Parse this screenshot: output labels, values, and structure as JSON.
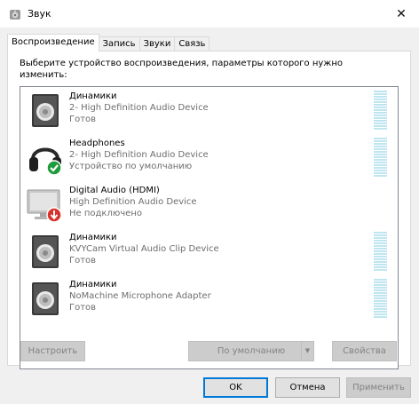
{
  "window": {
    "title": "Звук"
  },
  "tabs": [
    {
      "label": "Воспроизведение"
    },
    {
      "label": "Запись"
    },
    {
      "label": "Звуки"
    },
    {
      "label": "Связь"
    }
  ],
  "instruction": "Выберите устройство воспроизведения, параметры которого нужно изменить:",
  "devices": [
    {
      "name": "Динамики",
      "description": "2- High Definition Audio Device",
      "status": "Готов",
      "icon": "speaker-icon"
    },
    {
      "name": "Headphones",
      "description": "2- High Definition Audio Device",
      "status": "Устройство по умолчанию",
      "icon": "headphones-icon"
    },
    {
      "name": "Digital Audio (HDMI)",
      "description": "High Definition Audio Device",
      "status": "Не подключено",
      "icon": "monitor-icon"
    },
    {
      "name": "Динамики",
      "description": "KVYCam Virtual Audio Clip Device",
      "status": "Готов",
      "icon": "speaker-icon"
    },
    {
      "name": "Динамики",
      "description": "NoMachine Microphone Adapter",
      "status": "Готов",
      "icon": "speaker-icon"
    }
  ],
  "panel_buttons": {
    "configure": "Настроить",
    "set_default": "По умолчанию",
    "properties": "Свойства"
  },
  "dialog_buttons": {
    "ok": "OK",
    "cancel": "Отмена",
    "apply": "Применить"
  },
  "colors": {
    "accent": "#0078d7",
    "default_badge": "#1e9b3a",
    "disconnected_badge": "#d9312b",
    "meter": "#bfe6f0"
  }
}
